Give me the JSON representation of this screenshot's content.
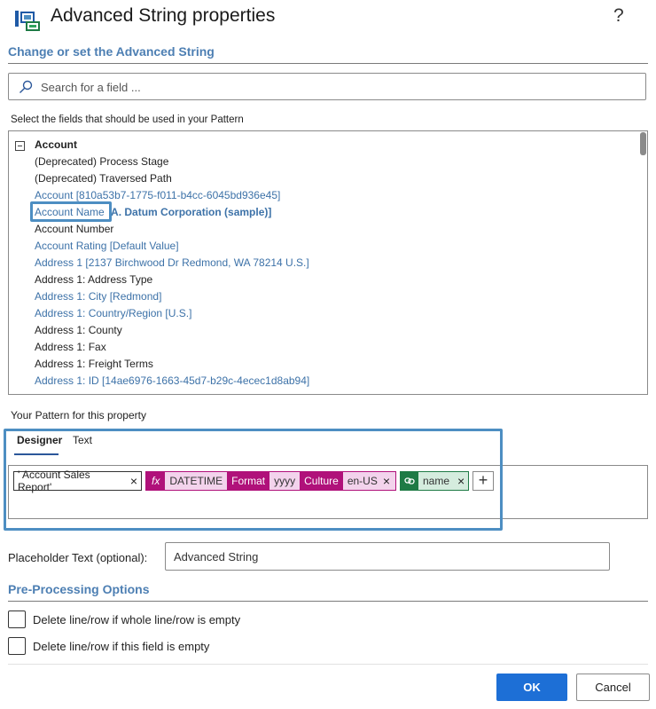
{
  "dialog": {
    "title": "Advanced String properties",
    "help_glyph": "?"
  },
  "change_section": {
    "heading": "Change or set the Advanced String"
  },
  "search": {
    "placeholder": "Search for a field ..."
  },
  "fields_label": "Select the fields that should be used in your Pattern",
  "tree": {
    "root": "Account",
    "items": [
      {
        "label": "(Deprecated) Process Stage",
        "style": "black"
      },
      {
        "label": "(Deprecated) Traversed Path",
        "style": "black"
      },
      {
        "label": "Account [810a53b7-1775-f011-b4cc-6045bd936e45]",
        "style": "blue"
      },
      {
        "label": "Account Name",
        "value": "A. Datum Corporation (sample)]",
        "style": "blue"
      },
      {
        "label": "Account Number",
        "style": "black"
      },
      {
        "label": "Account Rating [Default Value]",
        "style": "blue"
      },
      {
        "label": "Address 1 [2137 Birchwood Dr Redmond, WA 78214 U.S.]",
        "style": "blue"
      },
      {
        "label": "Address 1: Address Type",
        "style": "black"
      },
      {
        "label": "Address 1: City [Redmond]",
        "style": "blue"
      },
      {
        "label": "Address 1: Country/Region [U.S.]",
        "style": "blue"
      },
      {
        "label": "Address 1: County",
        "style": "black"
      },
      {
        "label": "Address 1: Fax",
        "style": "black"
      },
      {
        "label": "Address 1: Freight Terms",
        "style": "black"
      },
      {
        "label": "Address 1: ID [14ae6976-1663-45d7-b29c-4ecec1d8ab94]",
        "style": "blue"
      }
    ]
  },
  "pattern": {
    "label": "Your Pattern for this property",
    "tabs": [
      "Designer",
      "Text"
    ],
    "active_tab": "Designer",
    "chips": {
      "literal": "' Account Sales Report'",
      "fx": {
        "icon": "fx",
        "func": "DATETIME",
        "format_key": "Format",
        "format_val": "yyyy",
        "culture_key": "Culture",
        "culture_val": "en-US"
      },
      "field": {
        "icon": "link-icon",
        "name": "name"
      },
      "close_glyph": "×",
      "add_glyph": "+"
    }
  },
  "placeholder": {
    "label": "Placeholder Text (optional):",
    "value": "Advanced String"
  },
  "preprocessing": {
    "heading": "Pre-Processing Options",
    "options": [
      {
        "label": "Delete line/row if whole line/row is empty",
        "checked": false
      },
      {
        "label": "Delete line/row if this field is empty",
        "checked": false
      }
    ]
  },
  "buttons": {
    "ok": "OK",
    "cancel": "Cancel"
  },
  "colors": {
    "accent": "#1d6fd6",
    "heading_blue": "#4d7fb3",
    "highlight": "#4d8ec2",
    "fx_magenta": "#b0117a",
    "field_green": "#1e7a45"
  }
}
